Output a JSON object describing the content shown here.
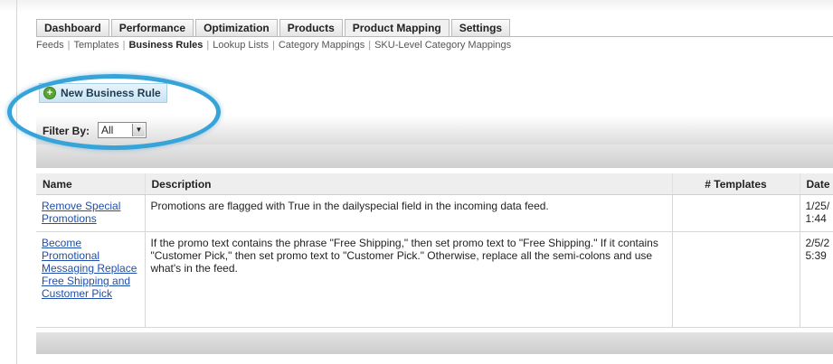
{
  "tabs": [
    {
      "label": "Dashboard",
      "active": false
    },
    {
      "label": "Performance",
      "active": false
    },
    {
      "label": "Optimization",
      "active": false
    },
    {
      "label": "Products",
      "active": false
    },
    {
      "label": "Product Mapping",
      "active": true
    },
    {
      "label": "Settings",
      "active": false
    }
  ],
  "subnav": [
    {
      "label": "Feeds",
      "active": false
    },
    {
      "label": "Templates",
      "active": false
    },
    {
      "label": "Business Rules",
      "active": true
    },
    {
      "label": "Lookup Lists",
      "active": false
    },
    {
      "label": "Category Mappings",
      "active": false
    },
    {
      "label": "SKU-Level Category Mappings",
      "active": false
    }
  ],
  "new_rule_button": {
    "label": "New Business Rule",
    "icon": "plus-circle-icon"
  },
  "filter": {
    "label": "Filter By:",
    "selected": "All",
    "icon": "dropdown-arrow-icon"
  },
  "table": {
    "headers": {
      "name": "Name",
      "description": "Description",
      "templates": "# Templates",
      "date": "Date"
    },
    "rows": [
      {
        "name": "Remove Special Promotions",
        "description": "Promotions are flagged with True in the dailyspecial field in the incoming data feed.",
        "templates": "",
        "date_line1": "1/25/",
        "date_line2": "1:44"
      },
      {
        "name": "Become Promotional Messaging Replace Free Shipping and Customer Pick",
        "description": "If the promo text contains the phrase \"Free Shipping,\" then set promo text to \"Free Shipping.\" If it contains \"Customer Pick,\" then set promo text to \"Customer Pick.\" Otherwise, replace all the semi-colons and use what's in the feed.",
        "templates": "",
        "date_line1": "2/5/2",
        "date_line2": "5:39"
      }
    ]
  },
  "colors": {
    "highlight_ring": "#36a4d8",
    "link": "#1f4fa8",
    "button_bg": "#c9e4f3"
  }
}
